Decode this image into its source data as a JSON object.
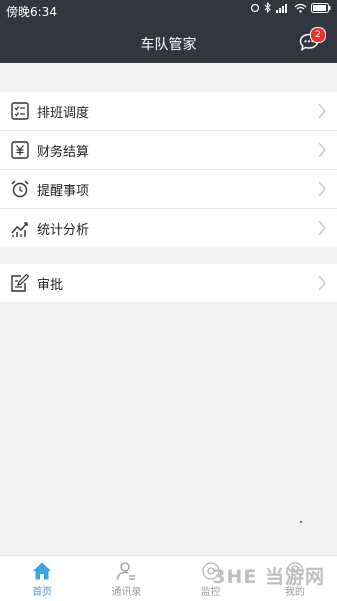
{
  "status_bar": {
    "time": "傍晚6:34"
  },
  "header": {
    "title": "车队管家",
    "message_badge": "2"
  },
  "menu_group_1": {
    "items": [
      {
        "label": "排班调度",
        "icon": "schedule-icon"
      },
      {
        "label": "财务结算",
        "icon": "finance-icon"
      },
      {
        "label": "提醒事项",
        "icon": "alarm-clock-icon"
      },
      {
        "label": "统计分析",
        "icon": "chart-icon"
      }
    ]
  },
  "menu_group_2": {
    "items": [
      {
        "label": "审批",
        "icon": "approval-icon"
      }
    ]
  },
  "tabbar": {
    "tabs": [
      {
        "label": "首页",
        "icon": "home-icon",
        "active": true
      },
      {
        "label": "通讯录",
        "icon": "contacts-icon",
        "active": false
      },
      {
        "label": "监控",
        "icon": "monitor-icon",
        "active": false
      },
      {
        "label": "我的",
        "icon": "profile-icon",
        "active": false
      }
    ]
  },
  "watermark": {
    "text": "3HE 当游网"
  },
  "colors": {
    "header_bg": "#33363e",
    "accent": "#3aa3e6",
    "badge": "#e2332d"
  }
}
